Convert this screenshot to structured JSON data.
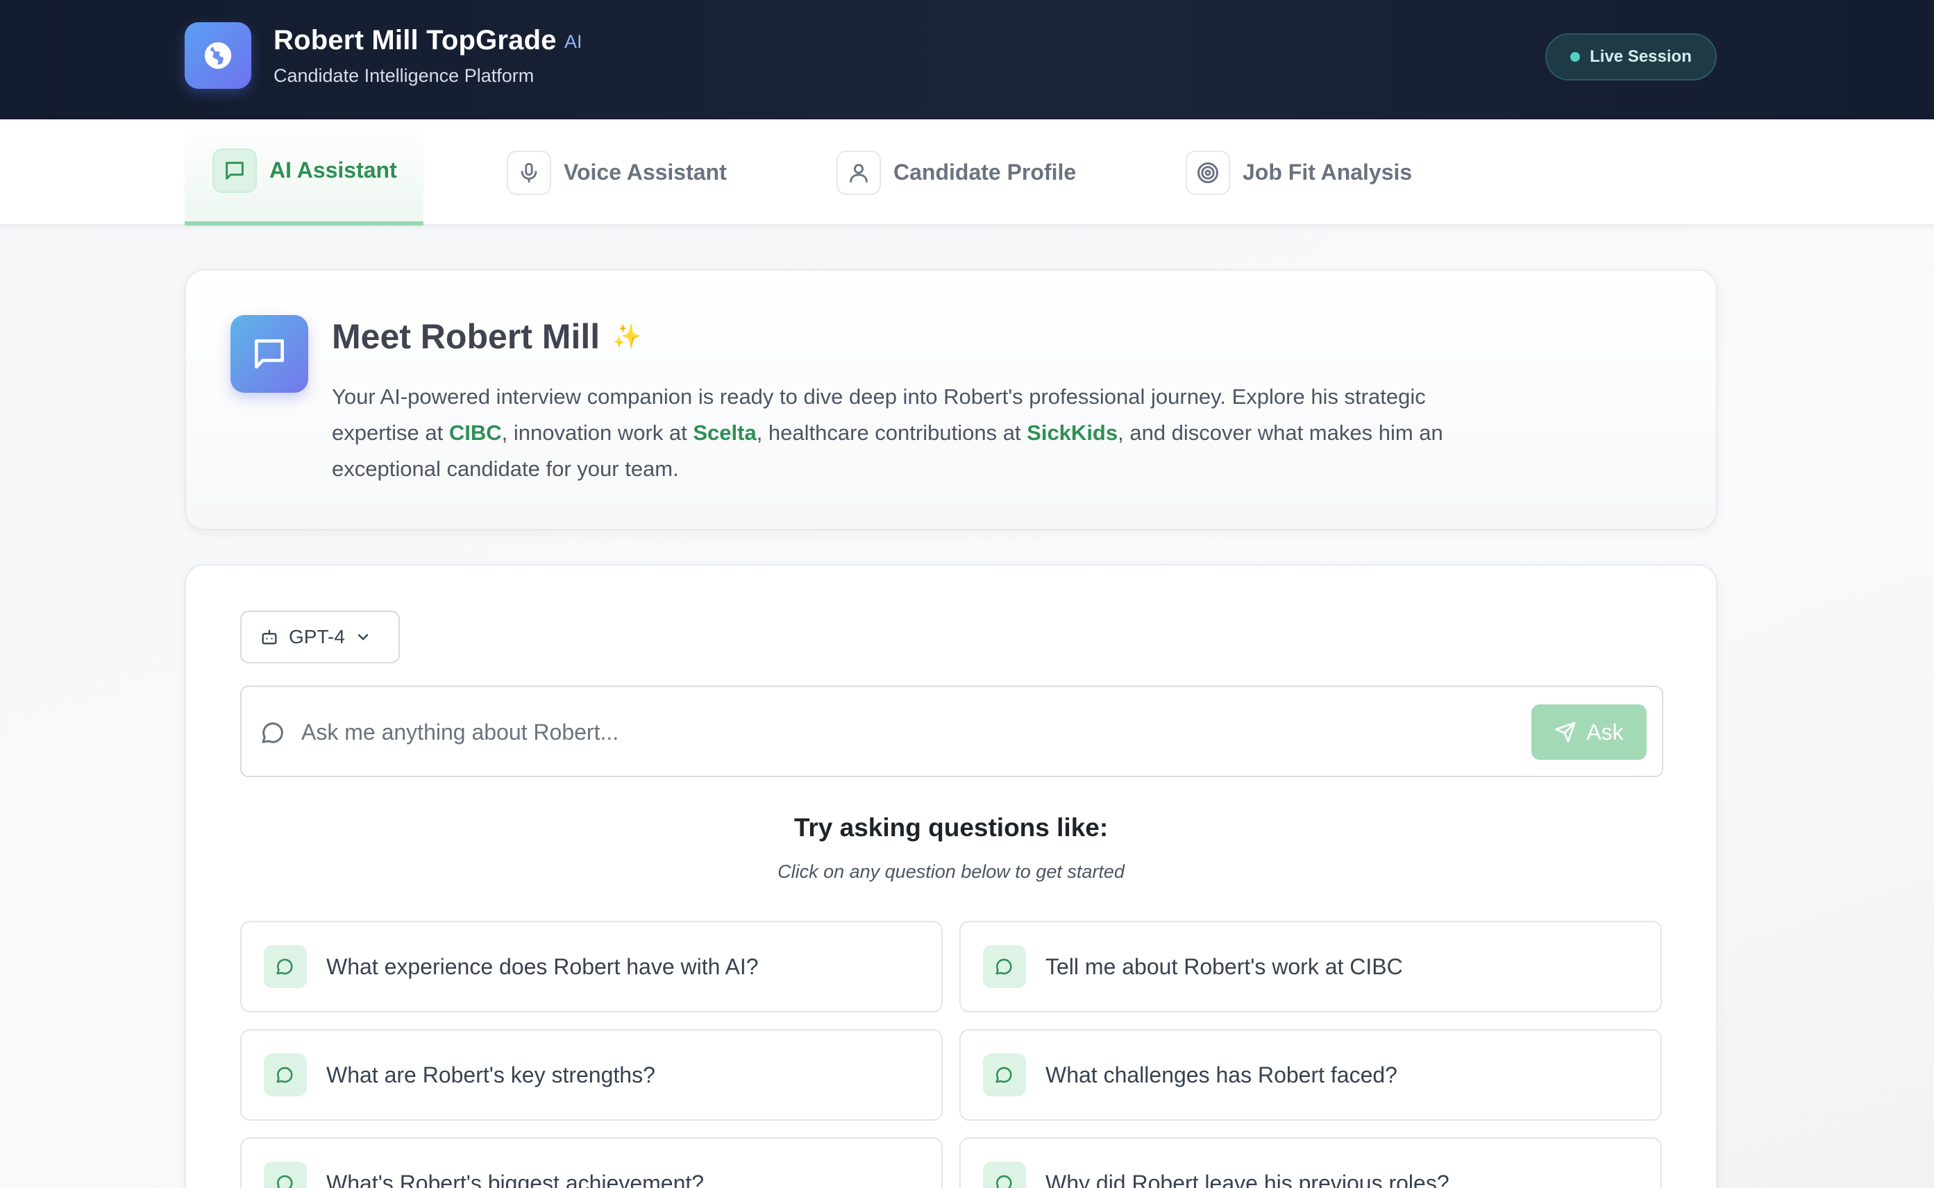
{
  "header": {
    "title": "Robert Mill TopGrade",
    "badge": "AI",
    "subtitle": "Candidate Intelligence Platform",
    "status": "Live Session",
    "logo_icon": "globe-icon"
  },
  "tabs": [
    {
      "label": "AI Assistant",
      "icon": "chat-icon",
      "active": true
    },
    {
      "label": "Voice Assistant",
      "icon": "microphone-icon",
      "active": false
    },
    {
      "label": "Candidate Profile",
      "icon": "user-icon",
      "active": false
    },
    {
      "label": "Job Fit Analysis",
      "icon": "target-icon",
      "active": false
    }
  ],
  "intro": {
    "title": "Meet Robert Mill",
    "sparkle": "✨",
    "text_1": "Your AI-powered interview companion is ready to dive deep into Robert's professional journey. Explore his strategic expertise at ",
    "highlight_1": "CIBC",
    "text_2": ", innovation work at ",
    "highlight_2": "Scelta",
    "text_3": ", healthcare contributions at ",
    "highlight_3": "SickKids",
    "text_4": ", and discover what makes him an exceptional candidate for your team."
  },
  "chat": {
    "model": "GPT-4",
    "input_placeholder": "Ask me anything about Robert...",
    "input_value": "",
    "ask_label": "Ask",
    "suggest_title": "Try asking questions like:",
    "suggest_subtitle": "Click on any question below to get started",
    "questions": [
      "What experience does Robert have with AI?",
      "Tell me about Robert's work at CIBC",
      "What are Robert's key strengths?",
      "What challenges has Robert faced?",
      "What's Robert's biggest achievement?",
      "Why did Robert leave his previous roles?"
    ]
  },
  "colors": {
    "header_bg": "#161e31",
    "accent_green": "#2f8f55",
    "active_tab_underline": "#94d8b0",
    "ask_button": "#a4d9b6",
    "live_dot": "#4fd1c5",
    "logo_gradient_start": "#5aa0f2",
    "logo_gradient_end": "#6f72ee"
  }
}
